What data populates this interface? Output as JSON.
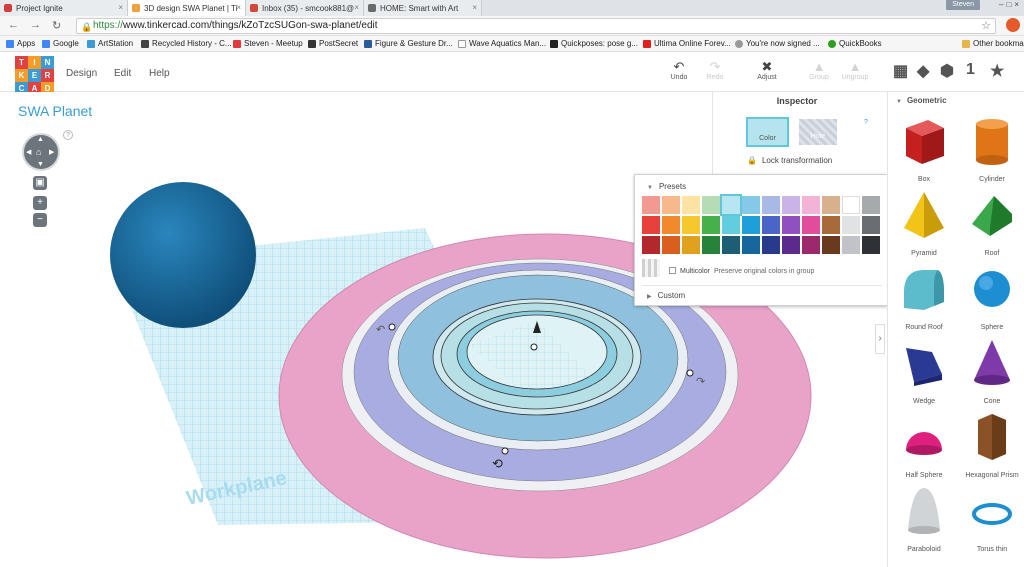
{
  "browser": {
    "tabs": [
      {
        "label": "Project Ignite",
        "color": "#d33d3d"
      },
      {
        "label": "3D design SWA Planet | Ti",
        "color": "#f2a03c"
      },
      {
        "label": "Inbox (35) - smcook881@",
        "color": "#d44638"
      },
      {
        "label": "HOME: Smart with Art",
        "color": "#6a6a6a"
      }
    ],
    "user": "Steven",
    "url_scheme": "https://",
    "url_rest": "www.tinkercad.com/things/kZoTzcSUGon-swa-planet/edit"
  },
  "bookmarks": [
    {
      "label": "Apps",
      "color": "#4285f4"
    },
    {
      "label": "Google",
      "color": "#4285f4"
    },
    {
      "label": "ArtStation",
      "color": "#3a9bd5"
    },
    {
      "label": "Recycled History - C...",
      "color": "#444444"
    },
    {
      "label": "Steven - Meetup",
      "color": "#e0393e"
    },
    {
      "label": "PostSecret",
      "color": "#333333"
    },
    {
      "label": "Figure & Gesture Dr...",
      "color": "#2a5c9a"
    },
    {
      "label": "Wave Aquatics Man...",
      "color": "#888888"
    },
    {
      "label": "Quickposes: pose g...",
      "color": "#222222"
    },
    {
      "label": "Ultima Online Forev...",
      "color": "#e02020"
    },
    {
      "label": "You're now signed ...",
      "color": "#999999"
    },
    {
      "label": "QuickBooks",
      "color": "#2ca01c"
    },
    {
      "label": "Other bookmarks",
      "color": "#e8b44c"
    }
  ],
  "tinkercad": {
    "logo_letters": [
      "TIN",
      "KER",
      "CAD"
    ],
    "logo_colors": [
      "#e04141",
      "#f39c27",
      "#3a9bd5"
    ],
    "menu": [
      "Design",
      "Edit",
      "Help"
    ],
    "tools": [
      {
        "label": "Undo",
        "glyph": "↶",
        "enabled": true
      },
      {
        "label": "Redo",
        "glyph": "↷",
        "enabled": false
      },
      {
        "label": "Adjust",
        "glyph": "✖",
        "enabled": true
      },
      {
        "label": "Group",
        "glyph": "▲",
        "enabled": false
      },
      {
        "label": "Ungroup",
        "glyph": "▲",
        "enabled": false
      }
    ],
    "view_icons": [
      "grid-icon",
      "cube-icon",
      "box-letter-icon",
      "number-icon",
      "star-icon"
    ],
    "number_icon_text": "1",
    "design_title": "SWA Planet",
    "workplane_label": "Workplane"
  },
  "inspector": {
    "title": "Inspector",
    "color_label": "Color",
    "hole_label": "Hole",
    "lock_label": "Lock transformation",
    "help": "?"
  },
  "color_popup": {
    "presets_label": "Presets",
    "custom_label": "Custom",
    "multicolor_label": "Multicolor",
    "multicolor_desc": "Preserve original colors in group",
    "selected": "#b8e6f0",
    "swatches": [
      "#f29a91",
      "#f7b98c",
      "#fde3a3",
      "#b5dcb2",
      "#b8e6f0",
      "#86c8e8",
      "#a9b9e6",
      "#cab3e6",
      "#f2b3d6",
      "#d9b08c",
      "#ffffff",
      "#a6aaad",
      "#e8413c",
      "#f28a2d",
      "#f7c82d",
      "#46b04a",
      "#63cde0",
      "#1e9fd9",
      "#4a64c8",
      "#9050c0",
      "#e04d9a",
      "#a86a3a",
      "#e0e2e4",
      "#6a6e72",
      "#b3282c",
      "#d95f1e",
      "#e0a11d",
      "#27833a",
      "#1e5e75",
      "#15679c",
      "#283a8c",
      "#5c2a8c",
      "#9c2a6a",
      "#6a3a1e",
      "#c0c4c8",
      "#2e3236"
    ]
  },
  "shapes_panel": {
    "title": "Geometric",
    "items": [
      {
        "label": "Box",
        "color": "#d42a2a",
        "icon": "box-icon"
      },
      {
        "label": "Cylinder",
        "color": "#e97d21",
        "icon": "cylinder-icon"
      },
      {
        "label": "Pyramid",
        "color": "#f2c418",
        "icon": "pyramid-icon"
      },
      {
        "label": "Roof",
        "color": "#2e9a3c",
        "icon": "roof-icon"
      },
      {
        "label": "Round Roof",
        "color": "#5cbccc",
        "icon": "round-roof-icon"
      },
      {
        "label": "Sphere",
        "color": "#1e8ed3",
        "icon": "sphere-icon"
      },
      {
        "label": "Wedge",
        "color": "#2a3a94",
        "icon": "wedge-icon"
      },
      {
        "label": "Cone",
        "color": "#7e3aa8",
        "icon": "cone-icon"
      },
      {
        "label": "Half Sphere",
        "color": "#e0207e",
        "icon": "half-sphere-icon"
      },
      {
        "label": "Hexagonal Prism",
        "color": "#8a5226",
        "icon": "hexagonal-prism-icon"
      },
      {
        "label": "Paraboloid",
        "color": "#d0d4d6",
        "icon": "paraboloid-icon"
      },
      {
        "label": "Torus thin",
        "color": "#1e8ed3",
        "icon": "torus-icon"
      }
    ]
  },
  "scene": {
    "sphere_color": "#1b6a9a",
    "ring_colors": [
      "#e9a3c9",
      "#e9e9f2",
      "#a9ace0",
      "#e6ecf2",
      "#8fc0dd",
      "#bfe3ea",
      "#7fc5d8",
      "#d8f0f4"
    ]
  }
}
